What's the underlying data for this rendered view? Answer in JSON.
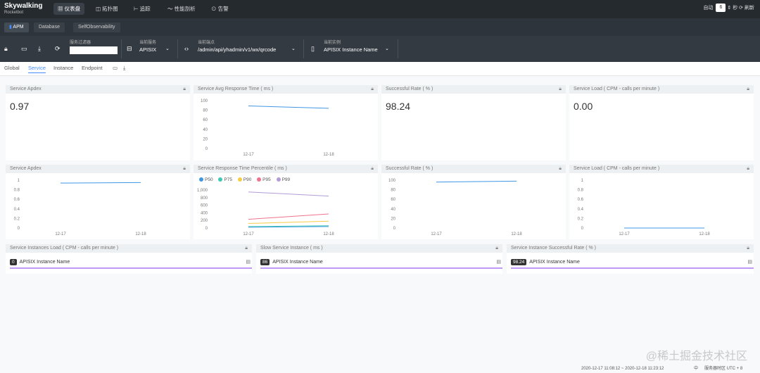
{
  "brand": {
    "name": "Skywalking",
    "sub": "Rocketbot"
  },
  "nav": [
    "仪表盘",
    "拓扑图",
    "追踪",
    "性能剖析",
    "告警"
  ],
  "topright": {
    "auto_label": "自动",
    "interval": "6",
    "unit": "秒",
    "refresh": "刷新"
  },
  "subtabs": [
    "APM",
    "Database",
    "SelfObservability"
  ],
  "toolbar": {
    "filter_label": "服务过滤器",
    "service_label": "当前服务",
    "service_value": "APISIX",
    "endpoint_label": "当前端点",
    "endpoint_value": "/admin/api/yhadmin/v1/wx/qrcode",
    "instance_label": "当前实例",
    "instance_value": "APISIX Instance Name"
  },
  "tabs": [
    "Global",
    "Service",
    "Instance",
    "Endpoint"
  ],
  "panels": {
    "p1": {
      "title": "Service Apdex",
      "value": "0.97"
    },
    "p2": {
      "title": "Service Avg Response Time ( ms )"
    },
    "p3": {
      "title": "Successful Rate ( % )",
      "value": "98.24"
    },
    "p4": {
      "title": "Service Load ( CPM - calls per minute )",
      "value": "0.00"
    },
    "p5": {
      "title": "Service Apdex"
    },
    "p6": {
      "title": "Service Response Time Percentile ( ms )"
    },
    "p7": {
      "title": "Successful Rate ( % )"
    },
    "p8": {
      "title": "Service Load ( CPM - calls per minute )"
    },
    "p9": {
      "title": "Service Instances Load ( CPM - calls per minute )",
      "badge": "0",
      "instance": "APISIX Instance Name"
    },
    "p10": {
      "title": "Slow Service Instance ( ms )",
      "badge": "86",
      "instance": "APISIX Instance Name"
    },
    "p11": {
      "title": "Service Instance Successful Rate ( % )",
      "badge": "98.24",
      "instance": "APISIX Instance Name"
    }
  },
  "legend": [
    {
      "name": "P50",
      "color": "#3f96e3"
    },
    {
      "name": "P75",
      "color": "#3fc8b4"
    },
    {
      "name": "P90",
      "color": "#f7cc45"
    },
    {
      "name": "P95",
      "color": "#f0728d"
    },
    {
      "name": "P99",
      "color": "#b39bd8"
    }
  ],
  "chart_data": [
    {
      "type": "line",
      "title": "Service Avg Response Time ( ms )",
      "x": [
        "12-17",
        "12-18"
      ],
      "ylim": [
        0,
        100
      ],
      "yticks": [
        "100",
        "80",
        "60",
        "40",
        "20",
        "0"
      ],
      "series": [
        {
          "values": [
            89,
            84
          ]
        }
      ]
    },
    {
      "type": "line",
      "title": "Service Apdex",
      "x": [
        "12-17",
        "12-18"
      ],
      "ylim": [
        0,
        1
      ],
      "yticks": [
        "1",
        "0.8",
        "0.6",
        "0.4",
        "0.2",
        "0"
      ],
      "series": [
        {
          "values": [
            0.94,
            0.95
          ]
        }
      ]
    },
    {
      "type": "line",
      "title": "Service Response Time Percentile ( ms )",
      "x": [
        "12-17",
        "12-18"
      ],
      "ylim": [
        0,
        1000
      ],
      "yticks": [
        "1,000",
        "800",
        "600",
        "400",
        "200",
        "0"
      ],
      "series": [
        {
          "name": "P50",
          "values": [
            20,
            40
          ]
        },
        {
          "name": "P75",
          "values": [
            40,
            60
          ]
        },
        {
          "name": "P90",
          "values": [
            120,
            180
          ]
        },
        {
          "name": "P95",
          "values": [
            230,
            370
          ]
        },
        {
          "name": "P99",
          "values": [
            950,
            840
          ]
        }
      ]
    },
    {
      "type": "line",
      "title": "Successful Rate ( % )",
      "x": [
        "12-17",
        "12-18"
      ],
      "ylim": [
        0,
        100
      ],
      "yticks": [
        "100",
        "80",
        "60",
        "40",
        "20",
        "0"
      ],
      "series": [
        {
          "values": [
            96,
            98
          ]
        }
      ]
    },
    {
      "type": "line",
      "title": "Service Load ( CPM - calls per minute )",
      "x": [
        "12-17",
        "12-18"
      ],
      "ylim": [
        0,
        1
      ],
      "yticks": [
        "1",
        "0.8",
        "0.6",
        "0.4",
        "0.2",
        "0"
      ],
      "series": [
        {
          "values": [
            0,
            0
          ]
        }
      ]
    }
  ],
  "footer": {
    "range": "2020-12-17 11:08:12 ~ 2020-12-18 11:23:12",
    "lang": "中",
    "tz": "服务器时区 UTC + 8"
  },
  "watermark": "@稀土掘金技术社区"
}
